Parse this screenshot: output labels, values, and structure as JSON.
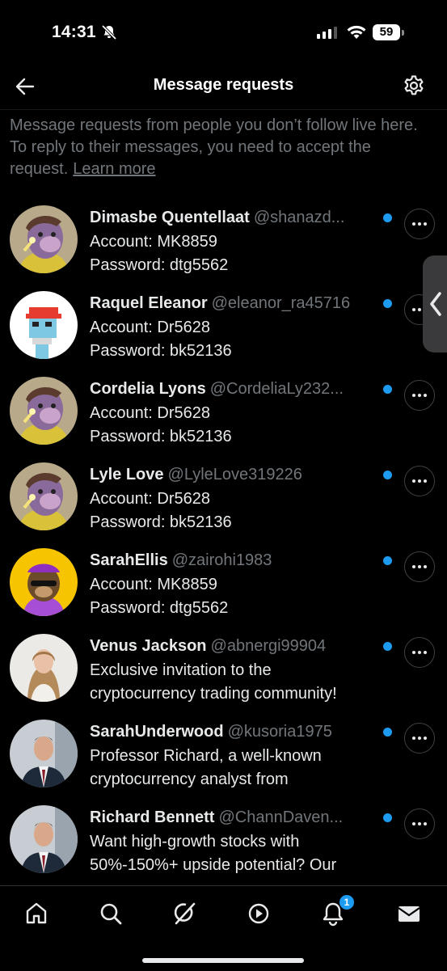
{
  "status_bar": {
    "time": "14:31",
    "battery": "59"
  },
  "header": {
    "title": "Message requests"
  },
  "intro": {
    "text": "Message requests from people you don’t follow live here. To reply to their messages, you need to accept the request.",
    "learn_more": "Learn more"
  },
  "requests": [
    {
      "name": "Dimasbe Quentellaat",
      "handle": "@shanazd...",
      "line1": "Account: MK8859",
      "line2": "Password: dtg5562",
      "avatar": "ape-purple"
    },
    {
      "name": "Raquel Eleanor",
      "handle": "@eleanor_ra45716",
      "line1": "Account: Dr5628",
      "line2": "Password: bk52136",
      "avatar": "pixel-punk"
    },
    {
      "name": "Cordelia Lyons",
      "handle": "@CordeliaLy232...",
      "line1": "Account: Dr5628",
      "line2": "Password: bk52136",
      "avatar": "ape-purple"
    },
    {
      "name": "Lyle Love",
      "handle": "@LyleLove319226",
      "line1": "Account: Dr5628",
      "line2": "Password: bk52136",
      "avatar": "ape-purple"
    },
    {
      "name": "SarahEllis",
      "handle": "@zairohi1983",
      "line1": "Account: MK8859",
      "line2": "Password: dtg5562",
      "avatar": "ape-yellow"
    },
    {
      "name": "Venus Jackson",
      "handle": "@abnergi99904",
      "line1": "Exclusive invitation to the",
      "line2": "cryptocurrency trading community!",
      "avatar": "woman-photo"
    },
    {
      "name": "SarahUnderwood",
      "handle": "@kusoria1975",
      "line1": "Professor Richard, a well-known",
      "line2": "cryptocurrency analyst from",
      "avatar": "man-suit-photo"
    },
    {
      "name": "Richard Bennett",
      "handle": "@ChannDaven...",
      "line1": "Want high-growth stocks with",
      "line2": "50%-150%+ upside potential? Our",
      "avatar": "man-suit-photo"
    }
  ],
  "nav": {
    "items": [
      "home-icon",
      "search-icon",
      "grok-icon",
      "video-icon",
      "notifications-icon",
      "messages-icon"
    ],
    "notification_count": "1"
  },
  "colors": {
    "accent": "#1d9bf0",
    "secondary_text": "#71767b",
    "background": "#000000"
  }
}
